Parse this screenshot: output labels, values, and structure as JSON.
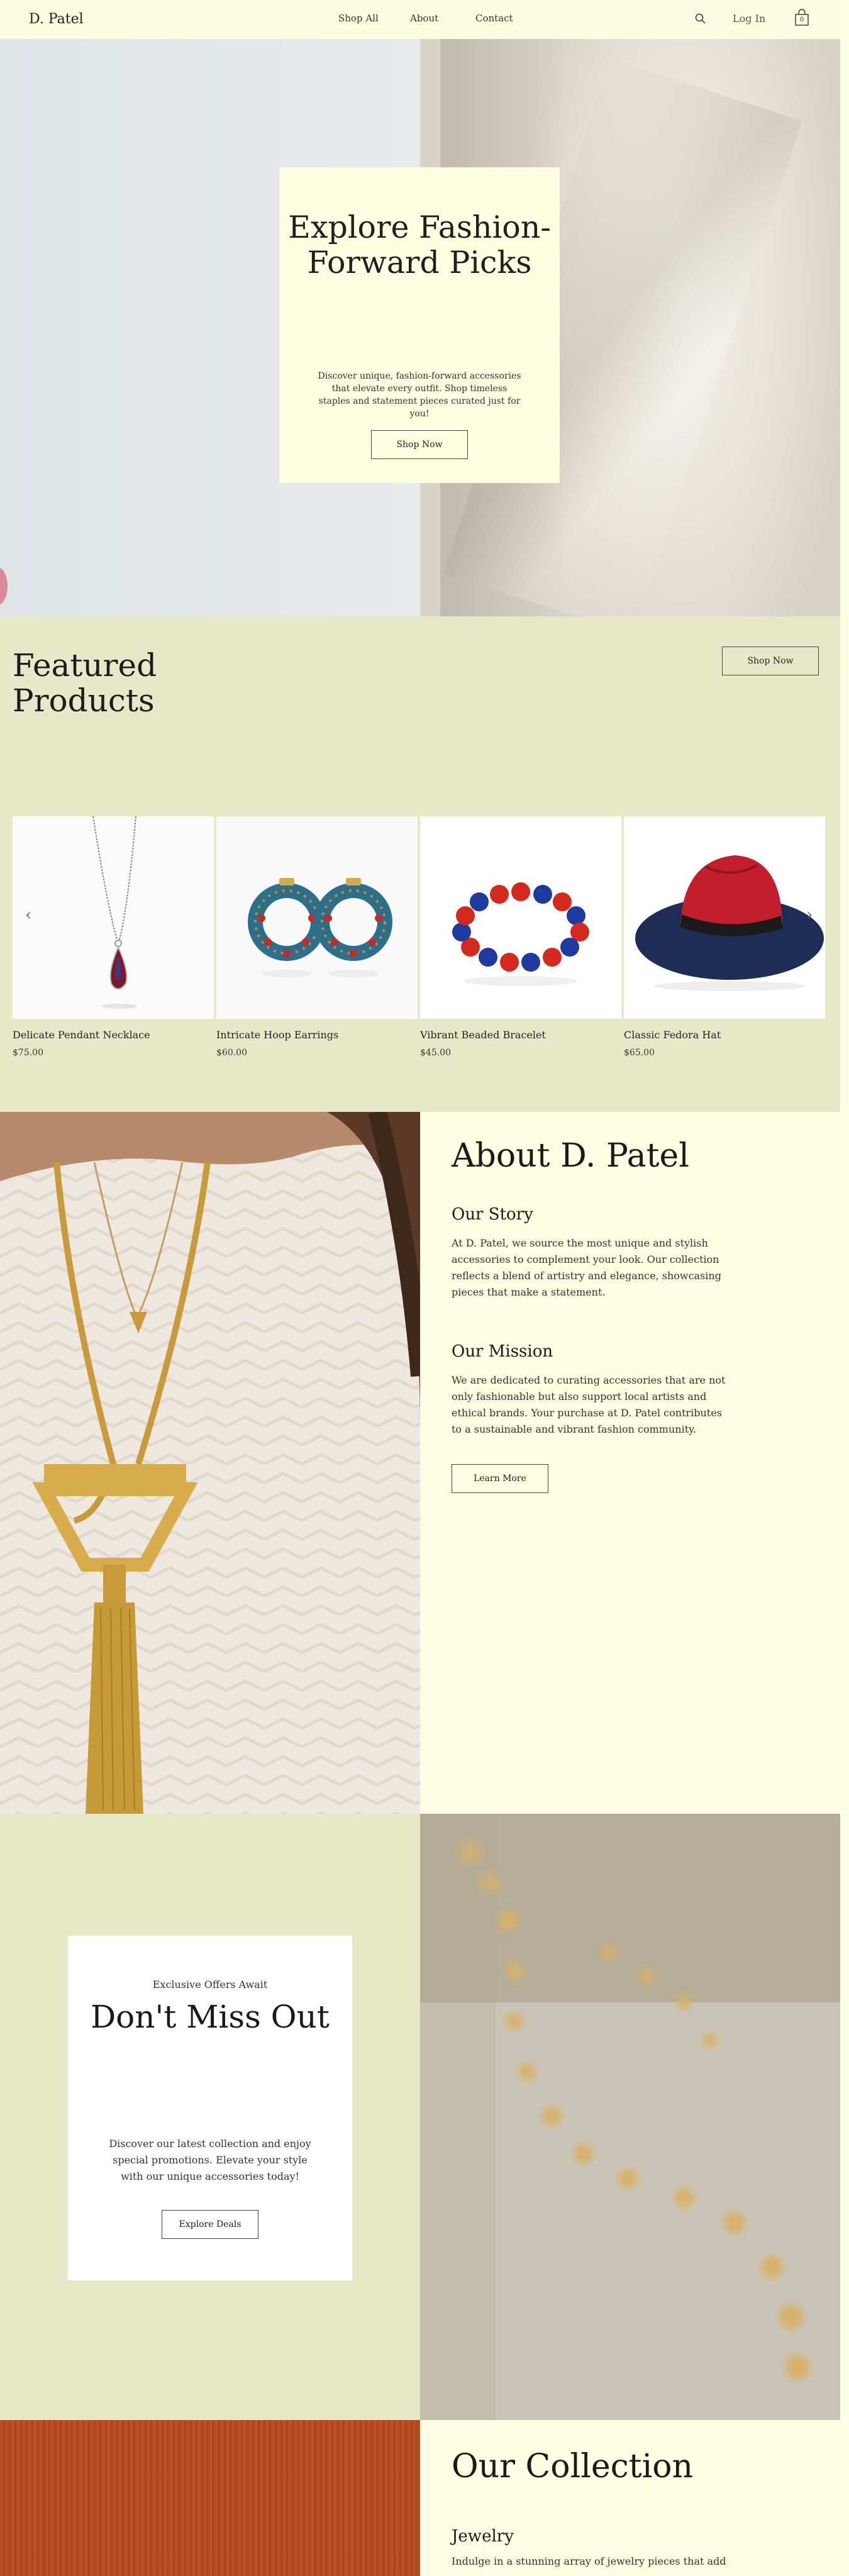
{
  "header": {
    "logo": "D. Patel",
    "nav": [
      "Shop All",
      "About",
      "Contact"
    ],
    "login": "Log In",
    "cart_count": "0",
    "icons": {
      "search": "search-icon",
      "cart": "cart-icon"
    }
  },
  "hero": {
    "title": "Explore Fashion-Forward Picks",
    "description": "Discover unique, fashion-forward accessories that elevate every outfit. Shop timeless staples and statement pieces curated just for you!",
    "button": "Shop Now"
  },
  "featured": {
    "title": "Featured Products",
    "button": "Shop Now",
    "prev_arrow": "‹",
    "next_arrow": "›",
    "products": [
      {
        "name": "Delicate Pendant Necklace",
        "price": "$75.00"
      },
      {
        "name": "Intricate Hoop Earrings",
        "price": "$60.00"
      },
      {
        "name": "Vibrant Beaded Bracelet",
        "price": "$45.00"
      },
      {
        "name": "Classic Fedora Hat",
        "price": "$65.00"
      }
    ]
  },
  "about": {
    "title": "About D. Patel",
    "story_heading": "Our Story",
    "story_text": "At D. Patel, we source the most unique and stylish accessories to complement your look. Our collection reflects a blend of artistry and elegance, showcasing pieces that make a statement.",
    "mission_heading": "Our Mission",
    "mission_text": "We are dedicated to curating accessories that are not only fashionable but also support local artists and ethical brands. Your purchase at D. Patel contributes to a sustainable and vibrant fashion community.",
    "button": "Learn More"
  },
  "deals": {
    "kicker": "Exclusive Offers Await",
    "title": "Don't Miss Out",
    "description": "Discover our latest collection and enjoy special promotions. Elevate your style with our unique accessories today!",
    "button": "Explore Deals"
  },
  "collection": {
    "title": "Our Collection",
    "jewelry_heading": "Jewelry",
    "jewelry_text": "Indulge in a stunning array of jewelry pieces that add"
  },
  "colors": {
    "header_bg": "#fcfde0",
    "sage_bg": "#e6e9c8",
    "cream_bg": "#fcfde1",
    "text": "#1a1a1a"
  }
}
